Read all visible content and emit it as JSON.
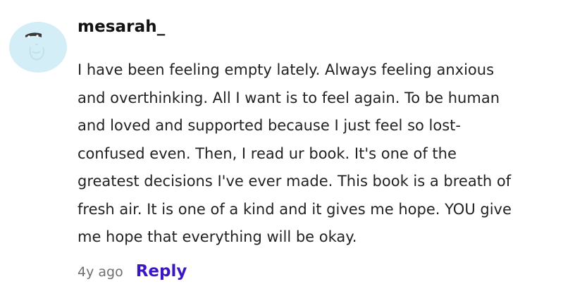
{
  "comment": {
    "username": "mesarah_",
    "avatar_icon": "avatar-icon",
    "avatar_bg": "#d4eef7",
    "lines": [
      "I have been feeling empty lately. Always feeling anxious",
      "and overthinking. All I want is to feel again. To be human",
      "and loved and supported because I just feel so lost-",
      "confused even. Then, I read ur book. It's one of the",
      "greatest decisions I've ever made. This book is a breath of",
      "fresh air. It is one of a kind and it gives me hope. YOU give",
      "me hope that everything will be okay."
    ],
    "timestamp": "4y ago",
    "reply_label": "Reply",
    "reply_color": "#3d16c4"
  }
}
